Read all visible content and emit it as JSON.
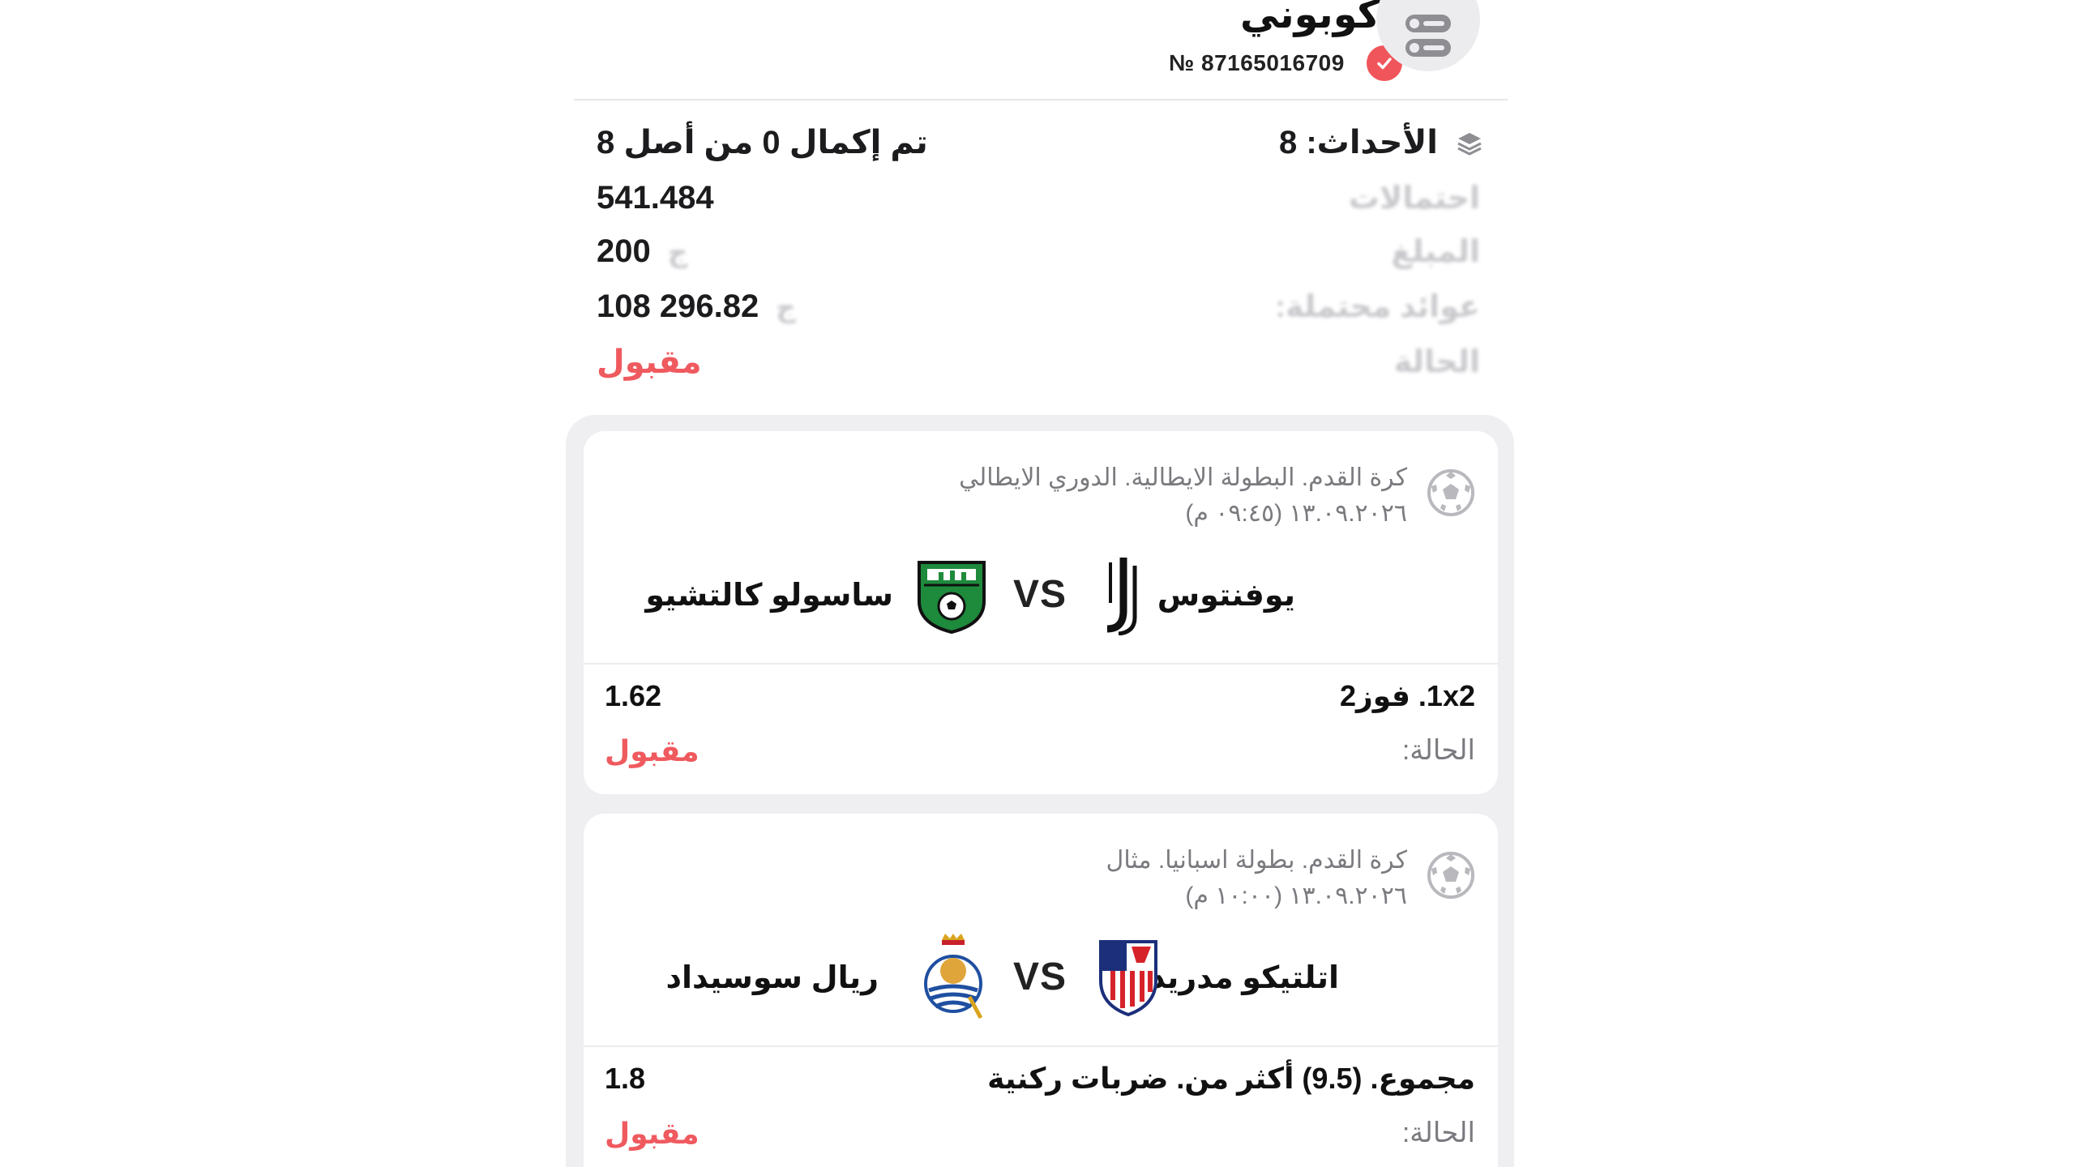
{
  "header": {
    "title": "كوبوني",
    "coupon_number": "№ 87165016709"
  },
  "summary": {
    "events_label": "الأحداث: 8",
    "progress": "تم إكمال 0 من أصل 8",
    "odds_label": "احتمالات",
    "odds_value": "541.484",
    "stake_label": "المبلغ",
    "stake_value": "200",
    "payout_label": "عوائد محتملة:",
    "payout_value": "108 296.82",
    "status_label": "الحالة",
    "status_value": "مقبول"
  },
  "events": [
    {
      "league": "كرة القدم. البطولة الايطالية. الدوري الايطالي",
      "date": "١٣.٠٩.٢٠٢٦ (٠٩:٤٥ م)",
      "home_team": "يوفنتوس",
      "away_team": "ساسولو كالتشيو",
      "vs": "VS",
      "market": "1x2. فوز2",
      "odds": "1.62",
      "status_label": "الحالة:",
      "status_value": "مقبول"
    },
    {
      "league": "كرة القدم. بطولة اسبانيا. مثال",
      "date": "١٣.٠٩.٢٠٢٦ (١٠:٠٠ م)",
      "home_team": "اتلتيكو مدريد",
      "away_team": "ريال سوسيداد",
      "vs": "VS",
      "market": "مجموع. (9.5) أكثر من. ضربات ركنية",
      "odds": "1.8",
      "status_label": "الحالة:",
      "status_value": "مقبول"
    }
  ],
  "colors": {
    "accent_red": "#ef5a5f",
    "muted_text": "#7a7a7f",
    "container_bg": "#efeff1"
  }
}
